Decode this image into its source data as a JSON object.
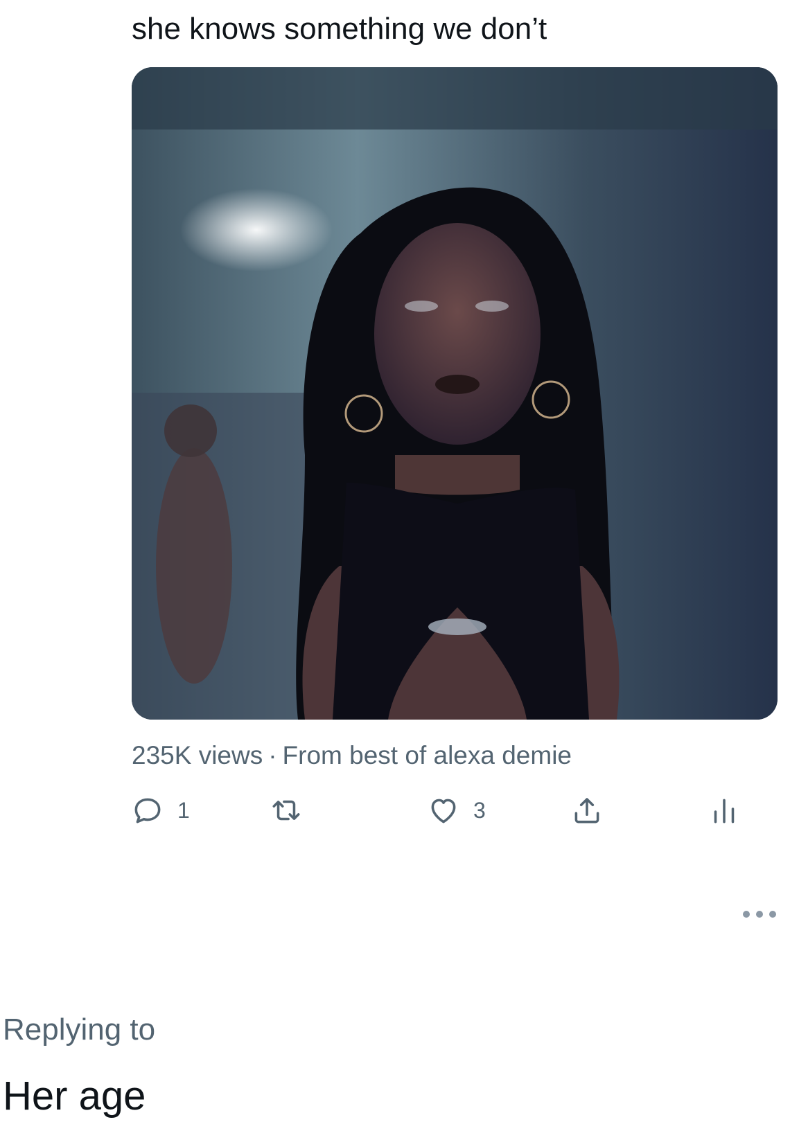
{
  "tweet": {
    "text": "she knows something we don’t",
    "media": {
      "kind": "video-still",
      "description_icon": "video-thumbnail"
    },
    "meta": {
      "views": "235K views",
      "separator": "·",
      "source": "From best of alexa demie"
    },
    "actions": {
      "reply": {
        "icon": "reply-icon",
        "count": "1"
      },
      "retweet": {
        "icon": "retweet-icon",
        "count": ""
      },
      "like": {
        "icon": "heart-icon",
        "count": "3"
      },
      "share": {
        "icon": "share-icon"
      },
      "analytics": {
        "icon": "analytics-icon"
      }
    }
  },
  "reply": {
    "replying_to_label": "Replying to",
    "text": "Her age"
  },
  "colors": {
    "text_primary": "#0f1419",
    "text_secondary": "#536471",
    "background": "#ffffff"
  }
}
